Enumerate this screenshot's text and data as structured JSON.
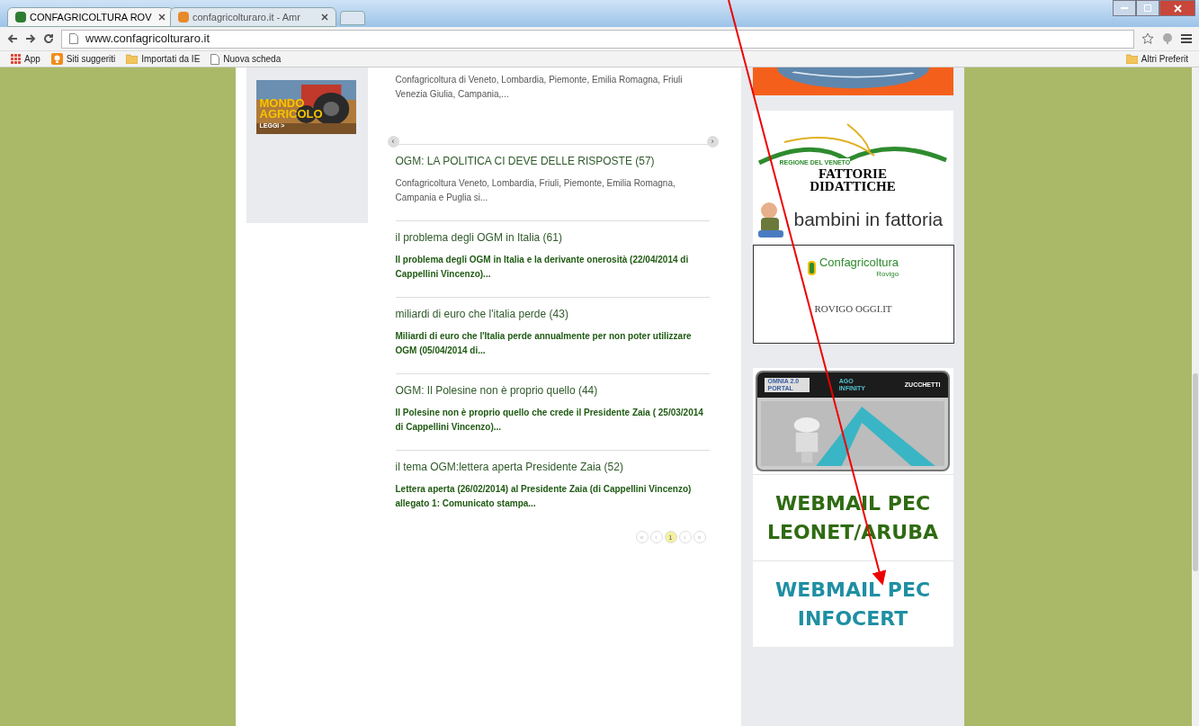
{
  "browser": {
    "tabs": [
      {
        "title": "CONFAGRICOLTURA ROV",
        "selected": true
      },
      {
        "title": "confagricolturaro.it - Amr",
        "selected": false
      }
    ],
    "url": "www.confagricolturaro.it",
    "bookmarks": [
      {
        "label": "App",
        "kind": "apps"
      },
      {
        "label": "Siti suggeriti",
        "kind": "suggested"
      },
      {
        "label": "Importati da IE",
        "kind": "folder"
      },
      {
        "label": "Nuova scheda",
        "kind": "page"
      }
    ],
    "other_bookmarks": "Altri Preferit"
  },
  "left_banner": {
    "title": "MONDO AGRICOLO",
    "link": "LEGGI >"
  },
  "articles": [
    {
      "excerpt": "Confagricoltura di Veneto, Lombardia, Piemonte, Emilia Romagna, Friuli Venezia Giulia, Campania,...",
      "emphasis": false
    },
    {
      "title": "OGM: LA POLITICA CI DEVE DELLE RISPOSTE (57)",
      "excerpt": "Confagricoltura Veneto, Lombardia, Friuli, Piemonte, Emilia Romagna, Campania e Puglia si...",
      "emphasis": false
    },
    {
      "title": "il problema degli OGM in Italia (61)",
      "excerpt": "Il problema degli OGM in Italia e la derivante onerosità (22/04/2014 di Cappellini Vincenzo)...",
      "emphasis": true
    },
    {
      "title": "miliardi di euro che l'italia perde (43)",
      "excerpt": "Miliardi di euro che l'Italia perde annualmente per non poter utilizzare OGM  (05/04/2014 di...",
      "emphasis": true
    },
    {
      "title": "OGM: Il Polesine non è proprio quello (44)",
      "excerpt": "Il Polesine non è proprio quello che crede il Presidente Zaia ( 25/03/2014 di Cappellini Vincenzo)...",
      "emphasis": true
    },
    {
      "title": "il tema OGM:lettera aperta Presidente Zaia (52)",
      "excerpt": "Lettera aperta  (26/02/2014)  al Presidente Zaia (di Cappellini Vincenzo)   allegato 1: Comunicato stampa...",
      "emphasis": true
    }
  ],
  "carousel": {
    "prev": "‹",
    "next": "›"
  },
  "pagination": [
    {
      "label": "«",
      "selected": false
    },
    {
      "label": "‹",
      "selected": false
    },
    {
      "label": "1",
      "selected": true
    },
    {
      "label": "›",
      "selected": false
    },
    {
      "label": "»",
      "selected": false
    }
  ],
  "right_banners": {
    "fattorie": {
      "region": "REGIONE DEL VENETO",
      "title": "FATTORIE DIDATTICHE"
    },
    "bambini": "bambini in fattoria",
    "confagricoltura": {
      "name": "Confagricoltura",
      "city": "Rovigo",
      "news": "ROVIGO OGGI.IT"
    },
    "omnia": {
      "left": "OMNIA 2.0 PORTAL",
      "middle": "AGO INFINITY",
      "right": "ZUCCHETTI"
    },
    "webmail": [
      {
        "line1": "WEBMAIL PEC",
        "line2": "LEONET/ARUBA",
        "color": "#2f6b12"
      },
      {
        "line1": "WEBMAIL PEC",
        "line2": "INFOCERT",
        "color": "#1f8fa3"
      }
    ]
  }
}
